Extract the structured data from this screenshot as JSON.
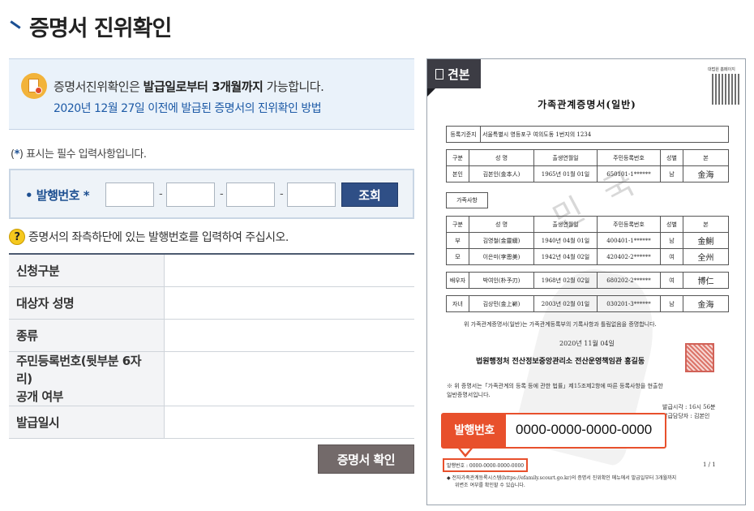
{
  "page": {
    "title": "증명서 진위확인"
  },
  "notice": {
    "line1_pre": "증명서진위확인은 ",
    "line1_bold": "발급일로부터 3개월까지",
    "line1_post": " 가능합니다.",
    "line2_link": "2020년 12월 27일 이전에 발급된 증명서의 진위확인 방법"
  },
  "required_note": {
    "open": "(",
    "star": "*",
    "rest": ") 표시는 필수 입력사항입니다."
  },
  "form": {
    "label": "• 발행번호",
    "required_mark": "*",
    "fields": [
      "",
      "",
      "",
      ""
    ],
    "dash": "-",
    "search_button": "조회"
  },
  "help": {
    "icon": "?",
    "text": "증명서의 좌측하단에 있는 발행번호를 입력하여 주십시오."
  },
  "result_rows": [
    {
      "label": "신청구분",
      "value": ""
    },
    {
      "label": "대상자 성명",
      "value": ""
    },
    {
      "label": "종류",
      "value": ""
    },
    {
      "label": "주민등록번호(뒷부분 6자리)\n공개 여부",
      "value": ""
    },
    {
      "label": "발급일시",
      "value": ""
    }
  ],
  "confirm_button": "증명서 확인",
  "sample": {
    "tag": "견본",
    "qr_caption": "대법원 홈페이지",
    "doc_title": "가족관계증명서(일반)",
    "reg_label": "등록기준지",
    "reg_value": "서울특별시 영등포구 여의도동 1번지의 1234",
    "columns": [
      "구분",
      "성   명",
      "출생연월일",
      "주민등록번호",
      "성별",
      "본"
    ],
    "self_row": [
      "본인",
      "김본인(金本人)",
      "1965년 01월 01일",
      "650101-1******",
      "남",
      "金海"
    ],
    "family_label": "가족사항",
    "family_rows": [
      [
        "부",
        "김영철(金靈綴)",
        "1940년 04월 01일",
        "400401-1******",
        "남",
        "金鯏"
      ],
      [
        "모",
        "이은미(李恩美)",
        "1942년 04월 02일",
        "420402-2******",
        "여",
        "全州"
      ],
      [
        "배우자",
        "박여인(朴予刃)",
        "1968년 02월 02일",
        "680202-2******",
        "여",
        "博仁"
      ],
      [
        "자녀",
        "김상민(金上嶄)",
        "2003년 02월 01일",
        "030201-3******",
        "남",
        "金海"
      ]
    ],
    "statement": "위 가족관계증명서(일반)는 가족관계등록부의 기록사항과 틀림없음을 증명합니다.",
    "date": "2020년 11월 04일",
    "office": "법원행정처 전산정보중앙관리소 전산운영책임관 홍길동",
    "note_line1": "※ 위 증명서는「가족관계의 등록 등에 관한 법률」제15조제2항에 따른 등록사항을 현출한",
    "note_line2": "일반증명서입니다.",
    "issue_time": "발급시각 : 16시 56분",
    "issuer": "발급담당자 : 김본인",
    "callout_label": "발행번호",
    "callout_value": "0000-0000-0000-0000",
    "issue_number_small": "발행번호 : 0000-0000-0000-0000",
    "page_count": "1 / 1",
    "footer_line1": "◆ 전자가족관계등록시스템(https://efamily.scourt.go.kr)의 증명서 진위확인 메뉴에서 발급일부터 3개월까지",
    "footer_line2": "위변조 여부를 확인할 수 있습니다."
  },
  "colors": {
    "title_mark": "#1b4f93",
    "search_button": "#2f4f86",
    "confirm_button": "#736a6a",
    "callout": "#e8502c"
  }
}
